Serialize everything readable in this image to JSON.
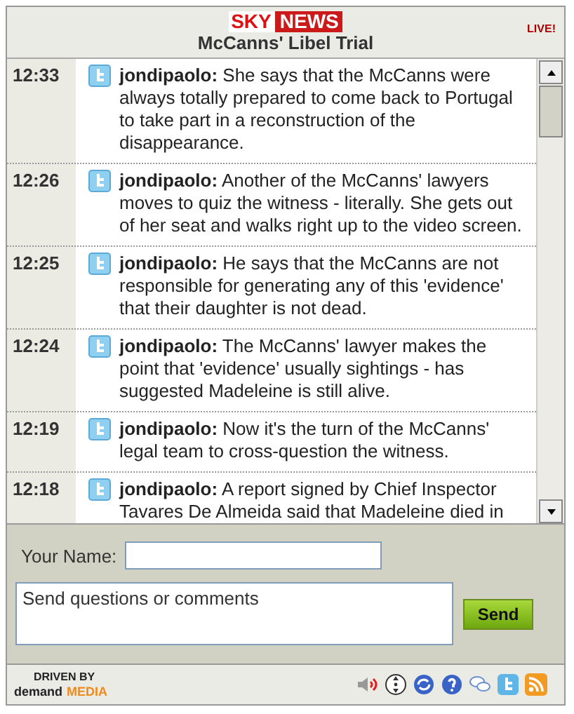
{
  "header": {
    "logo_sky": "SKY",
    "logo_news": "NEWS",
    "title": "McCanns' Libel Trial",
    "live": "LIVE!"
  },
  "feed": [
    {
      "time": "12:33",
      "text": "**jondipaolo:** She says that the McCanns were always totally prepared to come back to Portugal to take part in a reconstruction of the disappearance."
    },
    {
      "time": "12:26",
      "text": "**jondipaolo:** Another of the McCanns' lawyers moves to quiz the witness - literally. She gets out of her seat and walks right up to the video screen."
    },
    {
      "time": "12:25",
      "text": "**jondipaolo:** He says that the McCanns are not responsible for generating any of this 'evidence' that their daughter is not dead."
    },
    {
      "time": "12:24",
      "text": "**jondipaolo:** The McCanns' lawyer makes the point that 'evidence' usually sightings - has suggested Madeleine is still alive."
    },
    {
      "time": "12:19",
      "text": "**jondipaolo:** Now it's the turn of the McCanns' legal team to cross-question the witness."
    },
    {
      "time": "12:18",
      "text": "**jondipaolo:** A report signed by Chief Inspector Tavares De Almeida said that Madeleine died in"
    }
  ],
  "form": {
    "name_label": "Your Name:",
    "comment_placeholder": "Send questions or comments",
    "send": "Send"
  },
  "footer": {
    "driven_by": "DRIVEN BY",
    "brand_a": "demand",
    "brand_b": "MEDIA"
  }
}
